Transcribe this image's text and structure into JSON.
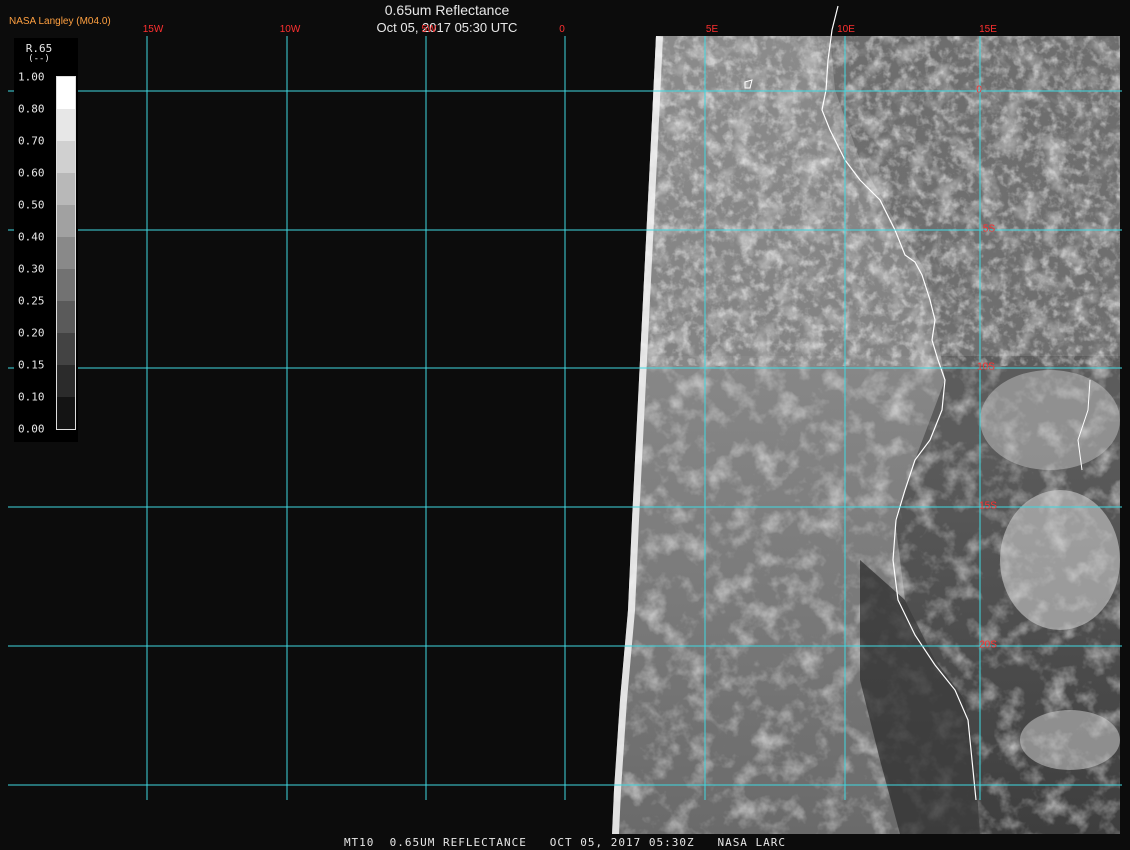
{
  "header": {
    "producer": "NASA Langley (M04.0)",
    "title": "0.65um Reflectance",
    "datetime": "Oct 05, 2017 05:30 UTC"
  },
  "grid": {
    "longitude_labels": [
      "15W",
      "10W",
      "5W",
      "0",
      "5E",
      "10E",
      "15E"
    ],
    "latitude_labels": [
      "0",
      "5S",
      "10S",
      "15S",
      "20S"
    ],
    "color": "#3fd8e0",
    "label_color": "#ff3030"
  },
  "legend": {
    "name": "R.65",
    "unit": "(--)",
    "ticks": [
      "1.00",
      "0.80",
      "0.70",
      "0.60",
      "0.50",
      "0.40",
      "0.30",
      "0.25",
      "0.20",
      "0.15",
      "0.10",
      "0.00"
    ]
  },
  "footer": {
    "text": "MT10  0.65UM REFLECTANCE   OCT 05, 2017 05:30Z   NASA LARC"
  },
  "imagery": {
    "coastline_color": "#ffffff",
    "space_color": "#0c0c0c"
  }
}
